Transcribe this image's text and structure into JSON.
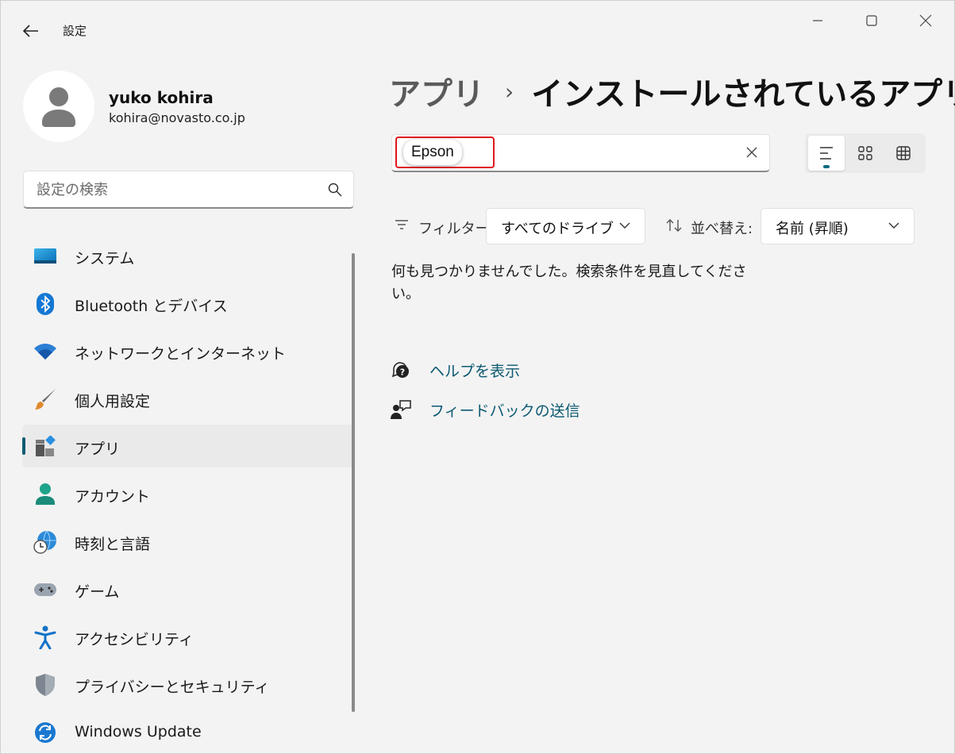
{
  "window": {
    "title": "設定"
  },
  "profile": {
    "name": "yuko kohira",
    "email": "kohira@novasto.co.jp"
  },
  "sidebar": {
    "search_placeholder": "設定の検索",
    "items": [
      {
        "label": "システム",
        "icon": "system-icon"
      },
      {
        "label": "Bluetooth とデバイス",
        "icon": "bluetooth-icon"
      },
      {
        "label": "ネットワークとインターネット",
        "icon": "wifi-icon"
      },
      {
        "label": "個人用設定",
        "icon": "brush-icon"
      },
      {
        "label": "アプリ",
        "icon": "apps-icon",
        "active": true
      },
      {
        "label": "アカウント",
        "icon": "account-icon"
      },
      {
        "label": "時刻と言語",
        "icon": "time-language-icon"
      },
      {
        "label": "ゲーム",
        "icon": "gamepad-icon"
      },
      {
        "label": "アクセシビリティ",
        "icon": "accessibility-icon"
      },
      {
        "label": "プライバシーとセキュリティ",
        "icon": "shield-icon"
      },
      {
        "label": "Windows Update",
        "icon": "windows-update-icon"
      }
    ]
  },
  "main": {
    "breadcrumb": {
      "parent": "アプリ",
      "separator": "›",
      "current": "インストールされているアプリ"
    },
    "app_search": {
      "value": "Epson"
    },
    "filter": {
      "label": "フィルター:",
      "value": "すべてのドライブ"
    },
    "sort": {
      "label": "並べ替え:",
      "value": "名前 (昇順)"
    },
    "empty_message": "何も見つかりませんでした。検索条件を見直してください。",
    "links": {
      "help": "ヘルプを表示",
      "feedback": "フィードバックの送信"
    }
  },
  "colors": {
    "accent": "#0f5c73",
    "link": "#0c5a73",
    "highlight_border": "#e0161b",
    "background": "#f3f3f3"
  }
}
